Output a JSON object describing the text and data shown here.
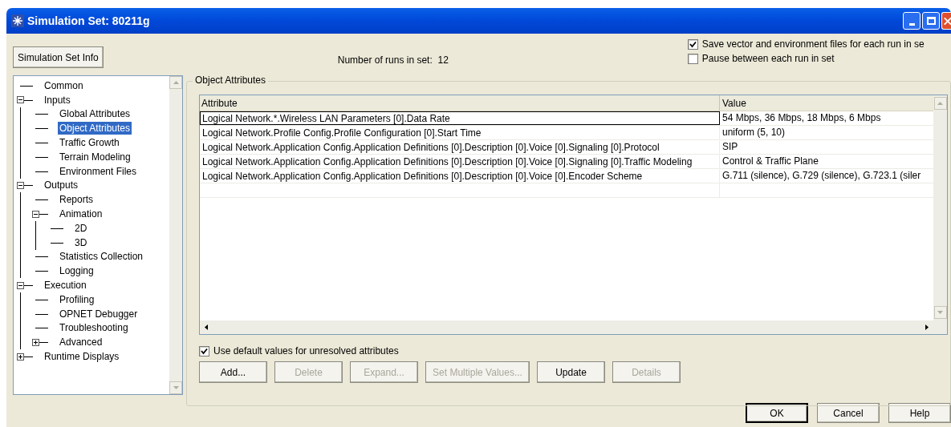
{
  "window": {
    "title": "Simulation Set: 80211g"
  },
  "info_button": "Simulation Set Info",
  "runs_label": "Number of runs in set:  12",
  "options": [
    {
      "label": "Save vector and environment files for each run in se",
      "checked": true
    },
    {
      "label": "Pause between each run in set",
      "checked": false
    }
  ],
  "tree": [
    {
      "label": "Common",
      "selected": false
    },
    {
      "label": "Inputs",
      "selected": false,
      "expanded": true,
      "children": [
        {
          "label": "Global Attributes",
          "selected": false
        },
        {
          "label": "Object Attributes",
          "selected": true
        },
        {
          "label": "Traffic Growth",
          "selected": false
        },
        {
          "label": "Terrain Modeling",
          "selected": false
        },
        {
          "label": "Environment Files",
          "selected": false
        }
      ]
    },
    {
      "label": "Outputs",
      "selected": false,
      "expanded": true,
      "children": [
        {
          "label": "Reports",
          "selected": false
        },
        {
          "label": "Animation",
          "selected": false,
          "expanded": true,
          "children": [
            {
              "label": "2D",
              "selected": false
            },
            {
              "label": "3D",
              "selected": false
            }
          ]
        },
        {
          "label": "Statistics Collection",
          "selected": false
        },
        {
          "label": "Logging",
          "selected": false
        }
      ]
    },
    {
      "label": "Execution",
      "selected": false,
      "expanded": true,
      "children": [
        {
          "label": "Profiling",
          "selected": false
        },
        {
          "label": "OPNET Debugger",
          "selected": false
        },
        {
          "label": "Troubleshooting",
          "selected": false
        },
        {
          "label": "Advanced",
          "selected": false,
          "expanded": false
        }
      ]
    },
    {
      "label": "Runtime Displays",
      "selected": false,
      "expanded": false
    }
  ],
  "group_title": "Object Attributes",
  "table": {
    "columns": [
      "Attribute",
      "Value"
    ],
    "rows": [
      {
        "attribute": "Logical Network.*.Wireless LAN Parameters [0].Data Rate",
        "value": "54 Mbps, 36 Mbps, 18 Mbps, 6 Mbps",
        "selected": true
      },
      {
        "attribute": "Logical Network.Profile Config.Profile Configuration [0].Start Time",
        "value": "uniform (5, 10)",
        "selected": false
      },
      {
        "attribute": "Logical Network.Application Config.Application Definitions [0].Description [0].Voice [0].Signaling [0].Protocol",
        "value": "SIP",
        "selected": false
      },
      {
        "attribute": "Logical Network.Application Config.Application Definitions [0].Description [0].Voice [0].Signaling [0].Traffic Modeling",
        "value": "Control & Traffic Plane",
        "selected": false
      },
      {
        "attribute": "Logical Network.Application Config.Application Definitions [0].Description [0].Voice [0].Encoder Scheme",
        "value": "G.711 (silence), G.729 (silence), G.723.1 (siler",
        "selected": false
      }
    ]
  },
  "use_default": {
    "label": "Use default values for unresolved attributes",
    "checked": true
  },
  "actions": [
    {
      "label": "Add...",
      "disabled": false
    },
    {
      "label": "Delete",
      "disabled": true
    },
    {
      "label": "Expand...",
      "disabled": true
    },
    {
      "label": "Set Multiple Values...",
      "disabled": true
    },
    {
      "label": "Update",
      "disabled": false
    },
    {
      "label": "Details",
      "disabled": true
    }
  ],
  "dialog_buttons": [
    "OK",
    "Cancel",
    "Help"
  ]
}
